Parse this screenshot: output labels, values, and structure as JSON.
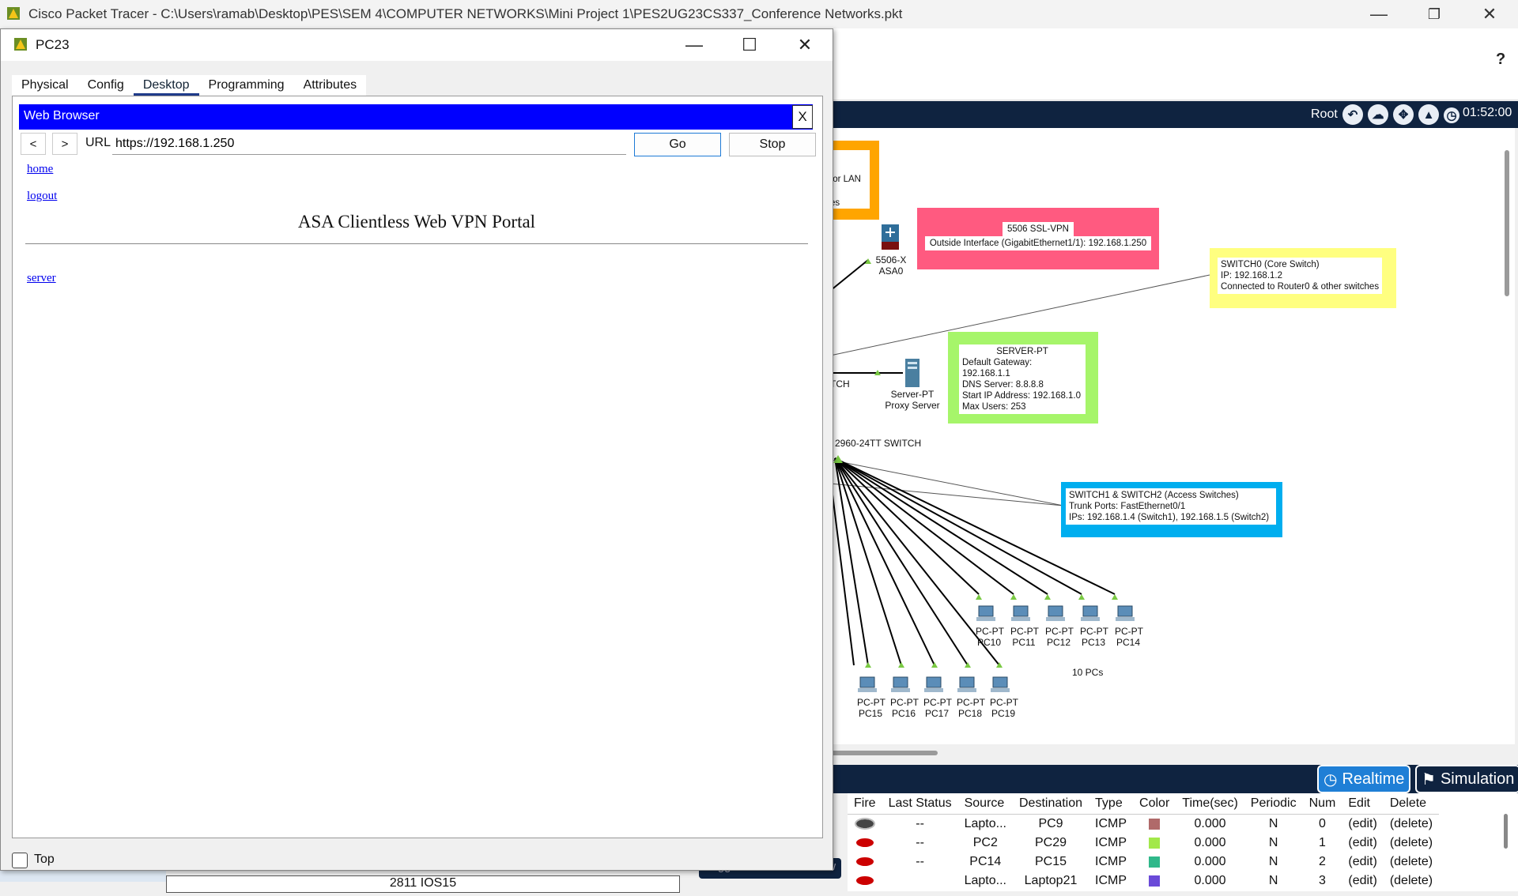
{
  "app": {
    "title": "Cisco Packet Tracer - C:\\Users\\ramab\\Desktop\\PES\\SEM 4\\COMPUTER NETWORKS\\Mini Project 1\\PES2UG23CS337_Conference Networks.pkt",
    "help": "?",
    "minimize": "—",
    "maximize": "❐",
    "close": "✕"
  },
  "workspace": {
    "root_label": "Root",
    "clock": "01:52:00",
    "notes": {
      "lan_partial_1": "for LAN",
      "lan_partial_2": "es",
      "ssl_vpn_title": "5506 SSL-VPN",
      "ssl_vpn_line": "Outside Interface (GigabitEthernet1/1): 192.168.1.250",
      "switch0_lines": [
        "SWITCH0 (Core Switch)",
        "IP: 192.168.1.2",
        "Connected to Router0 & other switches"
      ],
      "server_title": "SERVER-PT",
      "server_lines": [
        "Default Gateway: 192.168.1.1",
        "DNS Server: 8.8.8.8",
        "Start IP Address: 192.168.1.0",
        "Max Users: 253"
      ],
      "access_lines": [
        "SWITCH1 & SWITCH2 (Access Switches)",
        "Trunk Ports: FastEthernet0/1",
        "IPs: 192.168.1.4 (Switch1), 192.168.1.5 (Switch2)"
      ],
      "ten_pcs": "10 PCs"
    },
    "devices": {
      "asa_model": "5506-X",
      "asa_name": "ASA0",
      "server_model": "Server-PT",
      "server_name": "Proxy Server",
      "switch_partial": "TCH",
      "switch_label": "2960-24TT SWITCH",
      "pcs_top": [
        {
          "model": "PC-PT",
          "name": "PC10"
        },
        {
          "model": "PC-PT",
          "name": "PC11"
        },
        {
          "model": "PC-PT",
          "name": "PC12"
        },
        {
          "model": "PC-PT",
          "name": "PC13"
        },
        {
          "model": "PC-PT",
          "name": "PC14"
        }
      ],
      "pcs_bottom": [
        {
          "model": "PC-PT",
          "name": "PC15"
        },
        {
          "model": "PC-PT",
          "name": "PC16"
        },
        {
          "model": "PC-PT",
          "name": "PC17"
        },
        {
          "model": "PC-PT",
          "name": "PC18"
        },
        {
          "model": "PC-PT",
          "name": "PC19"
        }
      ]
    },
    "colors": {
      "ssl_vpn_note": "#ff5a80",
      "switch0_note": "#ffff80",
      "server_note": "#a6f56a",
      "access_note": "#00aeef",
      "lan_note": "#ffa500"
    }
  },
  "modes": {
    "realtime": "Realtime",
    "simulation": "Simulation"
  },
  "pdu": {
    "headers": [
      "Fire",
      "Last Status",
      "Source",
      "Destination",
      "Type",
      "Color",
      "Time(sec)",
      "Periodic",
      "Num",
      "Edit",
      "Delete"
    ],
    "rows": [
      {
        "status": "--",
        "source": "Lapto...",
        "destination": "PC9",
        "type": "ICMP",
        "color": "#b06a6a",
        "time": "0.000",
        "periodic": "N",
        "num": "0",
        "edit": "(edit)",
        "delete": "(delete)"
      },
      {
        "status": "--",
        "source": "PC2",
        "destination": "PC29",
        "type": "ICMP",
        "color": "#a2e84a",
        "time": "0.000",
        "periodic": "N",
        "num": "1",
        "edit": "(edit)",
        "delete": "(delete)"
      },
      {
        "status": "--",
        "source": "PC14",
        "destination": "PC15",
        "type": "ICMP",
        "color": "#2fb88a",
        "time": "0.000",
        "periodic": "N",
        "num": "2",
        "edit": "(edit)",
        "delete": "(delete)"
      },
      {
        "status": "",
        "source": "Lapto...",
        "destination": "Laptop21",
        "type": "ICMP",
        "color": "#6a4ad8",
        "time": "0.000",
        "periodic": "N",
        "num": "3",
        "edit": "(edit)",
        "delete": "(delete)"
      }
    ],
    "toggle_label": "Toggle PDU List Window"
  },
  "status_bar": {
    "device_label": "2811 IOS15"
  },
  "dialog": {
    "title": "PC23",
    "minimize": "—",
    "maximize": "☐",
    "close": "✕",
    "tabs": [
      "Physical",
      "Config",
      "Desktop",
      "Programming",
      "Attributes"
    ],
    "active_tab": "Desktop",
    "top_checkbox_label": "Top"
  },
  "browser": {
    "title": "Web Browser",
    "close": "X",
    "back": "<",
    "forward": ">",
    "url_label": "URL",
    "url": "https://192.168.1.250",
    "go": "Go",
    "stop": "Stop"
  },
  "webpage": {
    "links": [
      "home",
      "logout"
    ],
    "title": "ASA Clientless Web VPN Portal",
    "server_link": "server"
  }
}
